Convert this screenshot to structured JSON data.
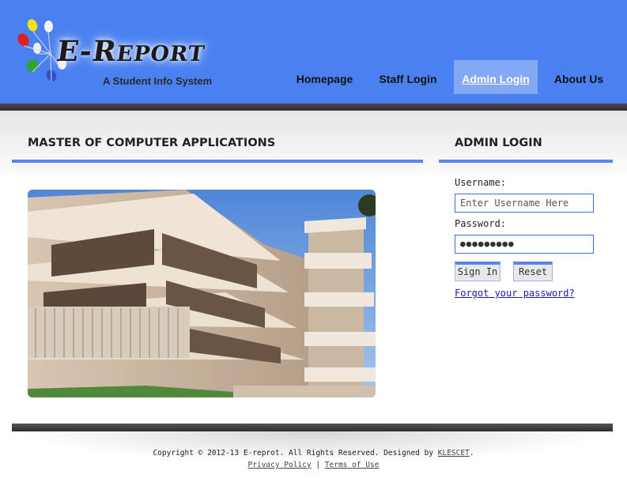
{
  "header": {
    "logo_title_big": "E-R",
    "logo_title_small": "EPORT",
    "tagline": "A Student Info System",
    "bg_color": "#4a80f0"
  },
  "nav": {
    "items": [
      {
        "label": "Homepage"
      },
      {
        "label": "Staff Login"
      },
      {
        "label": "Admin Login",
        "active": true
      },
      {
        "label": "About Us"
      }
    ]
  },
  "main": {
    "title": "MASTER OF COMPUTER APPLICATIONS",
    "image": "college-building-photo"
  },
  "login": {
    "title": "ADMIN LOGIN",
    "username_label": "Username:",
    "username_placeholder": "Enter Username Here",
    "password_label": "Password:",
    "password_value": "●●●●●●●●●",
    "sign_in_label": "Sign In",
    "reset_label": "Reset",
    "forgot_label": "Forgot your password?"
  },
  "footer": {
    "copyright": "Copyright © 2012-13 E-reprot. All Rights Reserved. Designed by ",
    "designer": "KLESCET",
    "period": ".",
    "privacy": "Privacy Policy",
    "separator": " | ",
    "terms": "Terms of Use"
  },
  "colors": {
    "accent": "#5a85ec",
    "active_nav": "#82a8f6",
    "link": "#1a1aa6"
  }
}
